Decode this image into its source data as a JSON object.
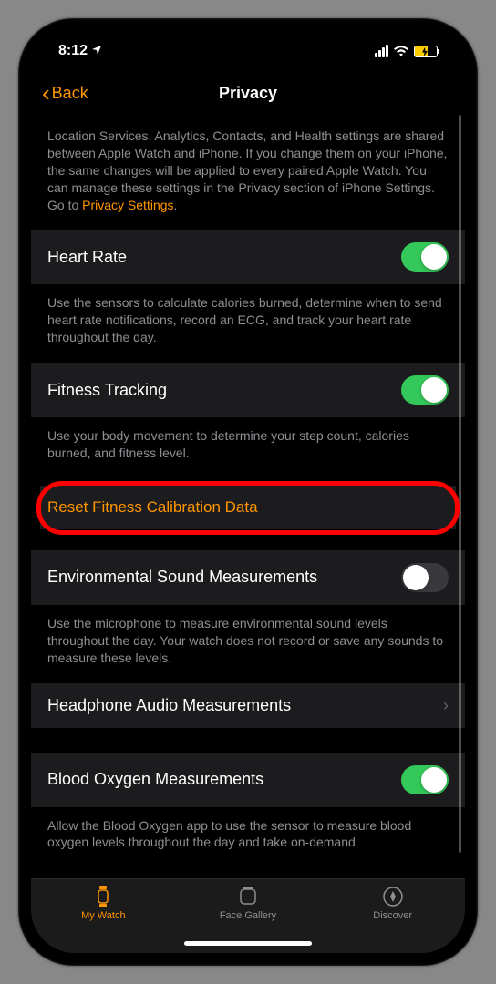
{
  "status_bar": {
    "time": "8:12",
    "location_arrow": "➤"
  },
  "nav": {
    "back_label": "Back",
    "title": "Privacy"
  },
  "intro": {
    "text": "Location Services, Analytics, Contacts, and Health settings are shared between Apple Watch and iPhone. If you change them on your iPhone, the same changes will be applied to every paired Apple Watch. You can manage these settings in the Privacy section of iPhone Settings. Go to ",
    "link": "Privacy Settings"
  },
  "settings": {
    "heart_rate": {
      "label": "Heart Rate",
      "desc": "Use the sensors to calculate calories burned, determine when to send heart rate notifications, record an ECG, and track your heart rate throughout the day.",
      "enabled": true
    },
    "fitness_tracking": {
      "label": "Fitness Tracking",
      "desc": "Use your body movement to determine your step count, calories burned, and fitness level.",
      "enabled": true
    },
    "reset_fitness": {
      "label": "Reset Fitness Calibration Data"
    },
    "env_sound": {
      "label": "Environmental Sound Measurements",
      "desc": "Use the microphone to measure environmental sound levels throughout the day. Your watch does not record or save any sounds to measure these levels.",
      "enabled": false
    },
    "headphone_audio": {
      "label": "Headphone Audio Measurements"
    },
    "blood_oxygen": {
      "label": "Blood Oxygen Measurements",
      "desc": "Allow the Blood Oxygen app to use the sensor to measure blood oxygen levels throughout the day and take on-demand",
      "enabled": true
    }
  },
  "tabs": {
    "my_watch": "My Watch",
    "face_gallery": "Face Gallery",
    "discover": "Discover"
  }
}
